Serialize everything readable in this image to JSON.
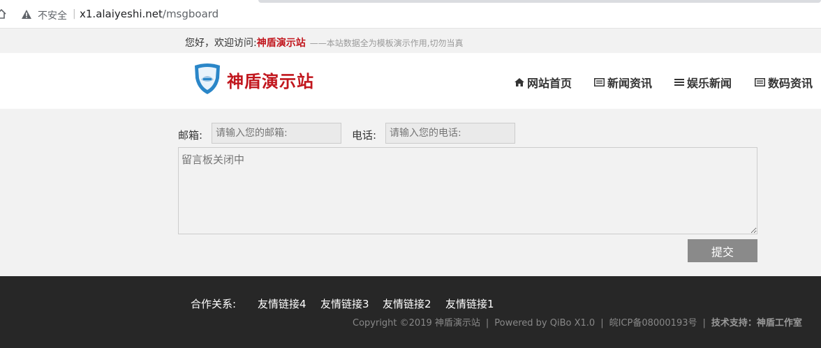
{
  "browser": {
    "insecure_label": "不安全",
    "separator": "|",
    "url_host": "x1.alaiyeshi.net",
    "url_path": "/msgboard"
  },
  "welcome": {
    "greeting": "您好，欢迎访问:",
    "site_name": "神盾演示站",
    "note": "——本站数据全为模板演示作用,切勿当真"
  },
  "header": {
    "logo_text": "神盾演示站",
    "nav": [
      {
        "label": "网站首页",
        "icon": "home-icon"
      },
      {
        "label": "新闻资讯",
        "icon": "list-icon"
      },
      {
        "label": "娱乐新闻",
        "icon": "menu-icon"
      },
      {
        "label": "数码资讯",
        "icon": "list-icon"
      }
    ]
  },
  "form": {
    "email_label": "邮箱:",
    "email_placeholder": "请输入您的邮箱:",
    "phone_label": "电话:",
    "phone_placeholder": "请输入您的电话:",
    "message_placeholder": "留言板关闭中",
    "submit_label": "提交"
  },
  "footer": {
    "partner_label": "合作关系:",
    "links": [
      "友情链接4",
      "友情链接3",
      "友情链接2",
      "友情链接1"
    ],
    "copyright": "Copyright ©2019 神盾演示站",
    "powered": "Powered by QiBo X1.0",
    "icp": "皖ICP备08000193号",
    "support": "技术支持：神盾工作室",
    "separator": "|"
  },
  "colors": {
    "brand_red": "#c1161d",
    "footer_bg": "#272727",
    "submit_bg": "#8a8a8a"
  }
}
